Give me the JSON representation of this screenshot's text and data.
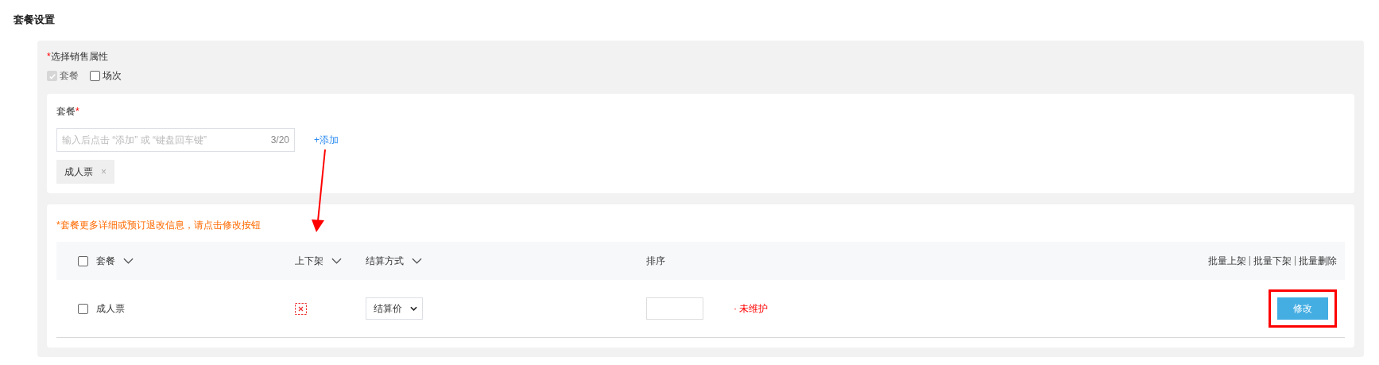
{
  "page_title": "套餐设置",
  "sale_attributes": {
    "required_mark": "*",
    "label": "选择销售属性",
    "options": [
      {
        "label": "套餐",
        "checked": true,
        "disabled": true
      },
      {
        "label": "场次",
        "checked": false,
        "disabled": false
      }
    ]
  },
  "package_card": {
    "label": "套餐",
    "required_mark": "*",
    "input": {
      "placeholder": "输入后点击 “添加” 或 “键盘回车键”",
      "counter": "3/20"
    },
    "add_link": "+添加",
    "tags": [
      {
        "label": "成人票",
        "close": "×"
      }
    ]
  },
  "table_card": {
    "notice": "*套餐更多详细或预订退改信息，请点击修改按钮",
    "select_all": {
      "checked": false
    },
    "columns": [
      {
        "label": "套餐",
        "filter": true
      },
      {
        "label": "上下架",
        "filter": true
      },
      {
        "label": "结算方式",
        "filter": true
      },
      {
        "label": "排序",
        "filter": false
      }
    ],
    "bulk_actions": [
      {
        "kind": "link",
        "label": "批量上架"
      },
      {
        "kind": "separator",
        "label": "|"
      },
      {
        "kind": "link",
        "label": "批量下架"
      },
      {
        "kind": "separator",
        "label": "|"
      },
      {
        "kind": "link",
        "label": "批量删除"
      }
    ],
    "rows": [
      {
        "checked": false,
        "name": "成人票",
        "listed": false,
        "settlement": "结算价",
        "warning": "· 未维护",
        "action": "修改",
        "highlighted": true
      }
    ]
  }
}
